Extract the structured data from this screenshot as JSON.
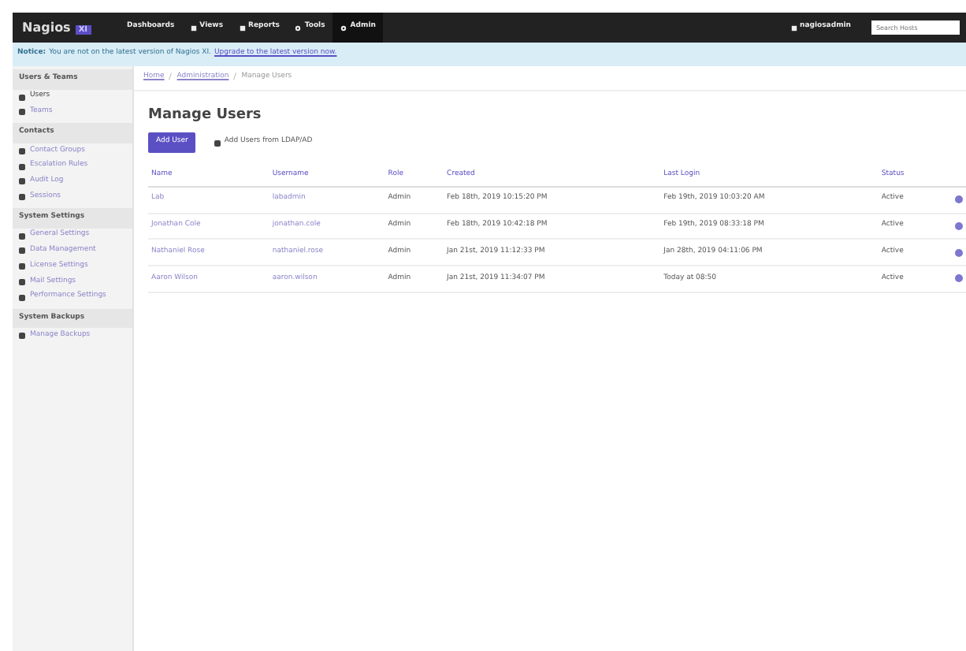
{
  "navbar": {
    "logo": "Nagios",
    "logo_badge": "XI",
    "items": [
      {
        "label": "Dashboards",
        "kind": "plain",
        "selected": false
      },
      {
        "label": "Views",
        "kind": "square",
        "selected": false
      },
      {
        "label": "Reports",
        "kind": "square",
        "selected": false
      },
      {
        "label": "Tools",
        "kind": "gear",
        "selected": false
      },
      {
        "label": "Admin",
        "kind": "gear",
        "selected": true
      }
    ],
    "user": "nagiosadmin",
    "search": {
      "placeholder": "Search Hosts"
    }
  },
  "notice": {
    "label": "Notice:",
    "text": "You are not on the latest version of Nagios XI.",
    "link": "Upgrade to the latest version now."
  },
  "sidebar": [
    {
      "title": "Users & Teams",
      "items": [
        {
          "label": "Users",
          "selected": true
        },
        {
          "label": "Teams",
          "selected": false
        }
      ]
    },
    {
      "title": "Contacts",
      "items": [
        {
          "label": "Contact Groups",
          "selected": false
        },
        {
          "label": "Escalation Rules",
          "selected": false
        },
        {
          "label": "Audit Log",
          "selected": false
        },
        {
          "label": "Sessions",
          "selected": false
        }
      ]
    },
    {
      "title": "System Settings",
      "items": [
        {
          "label": "General Settings",
          "selected": false
        },
        {
          "label": "Data Management",
          "selected": false
        },
        {
          "label": "License Settings",
          "selected": false
        },
        {
          "label": "Mail Settings",
          "selected": false
        },
        {
          "label": "Performance Settings",
          "selected": false
        }
      ]
    },
    {
      "title": "System Backups",
      "items": [
        {
          "label": "Manage Backups",
          "selected": false
        }
      ]
    }
  ],
  "breadcrumb": [
    "Home",
    "Administration",
    "Manage Users"
  ],
  "heading": "Manage Users",
  "buttons": [
    {
      "label": "Add User",
      "kind": "primary"
    },
    {
      "label": "Add Users from LDAP/AD",
      "kind": "link"
    }
  ],
  "table": {
    "columns": [
      "Name",
      "Username",
      "Role",
      "Created",
      "Last Login",
      "Status"
    ],
    "rows": [
      [
        "Lab",
        "labadmin",
        "Admin",
        "Feb 18th, 2019 10:15:20 PM",
        "Feb 19th, 2019 10:03:20 AM",
        "Active"
      ],
      [
        "Jonathan Cole",
        "jonathan.cole",
        "Admin",
        "Feb 18th, 2019 10:42:18 PM",
        "Feb 19th, 2019 08:33:18 PM",
        "Active"
      ],
      [
        "Nathaniel Rose",
        "nathaniel.rose",
        "Admin",
        "Jan 21st, 2019 11:12:33 PM",
        "Jan 28th, 2019 04:11:06 PM",
        "Active"
      ],
      [
        "Aaron Wilson",
        "aaron.wilson",
        "Admin",
        "Jan 21st, 2019 11:34:07 PM",
        "Today at 08:50",
        "Active"
      ]
    ]
  }
}
